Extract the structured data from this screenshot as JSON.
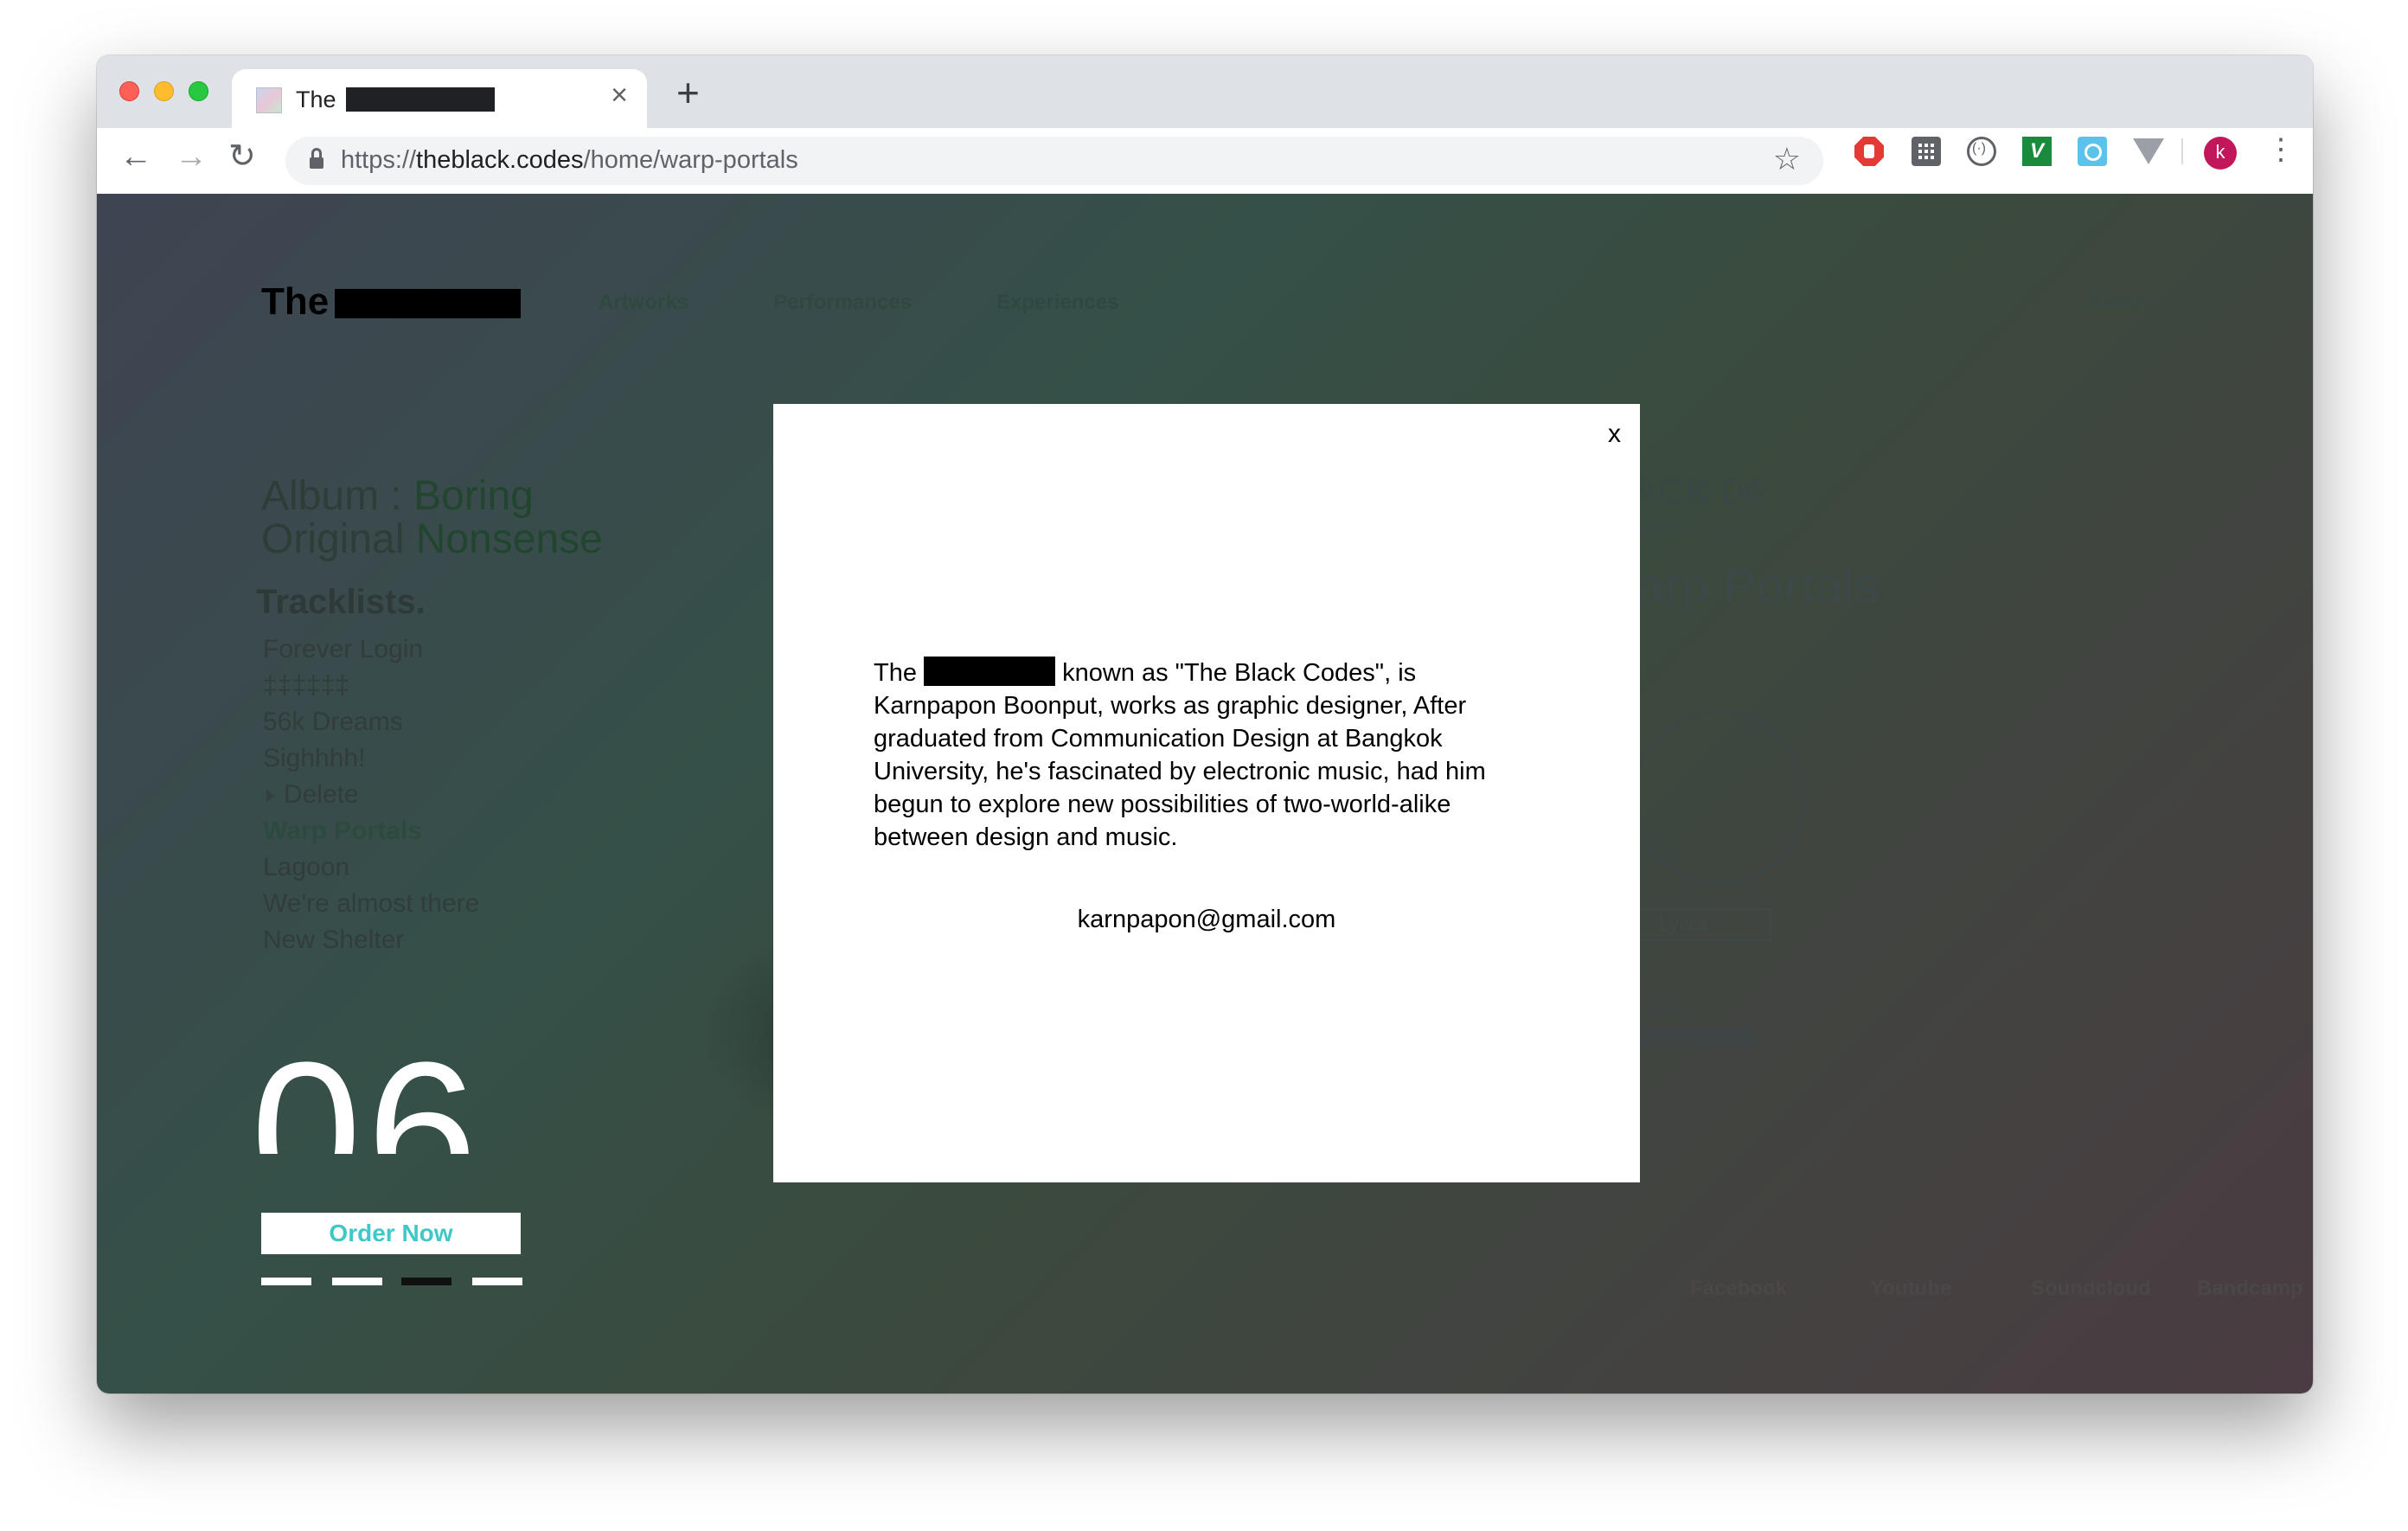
{
  "browser": {
    "tab": {
      "title": "The"
    },
    "new_tab_label": "+",
    "tab_close_label": "×",
    "url": {
      "prefix": "https://",
      "host": "theblack.codes",
      "path": "/home/warp-portals"
    },
    "profile_initial": "k",
    "extension_icons": [
      "stop-sign-icon",
      "grid-icon",
      "target-icon",
      "v-icon",
      "circle-icon",
      "triangle-icon"
    ]
  },
  "site": {
    "logo_text": "The",
    "nav": [
      "Artworks",
      "Performances",
      "Experiences"
    ],
    "about": "About",
    "album": {
      "label": "Album",
      "sep": " : ",
      "name": "Boring",
      "line2_a": "Original ",
      "line2_b": "Nonsense"
    },
    "tracklists_title": "Tracklists.",
    "tracks": [
      "Forever Login",
      "‡‡‡‡‡‡",
      "56k Dreams",
      "Sighhhh!",
      "Delete",
      "Warp Portals",
      "Lagoon",
      "We're almost there",
      "New Shelter"
    ],
    "big_number": "06",
    "order_button": "Order Now",
    "track_heading": "ACK 06",
    "release_date": "ed 15.11.2017",
    "track_name": "arp Portals",
    "lyrics_button": "Lyrics",
    "small_text": "k",
    "mapped_by": "pped by",
    "social": [
      "Facebook",
      "Youtube",
      "Soundcloud",
      "Bandcamp"
    ]
  },
  "modal": {
    "close_label": "x",
    "text_before": "The",
    "text_after": " known as \"The Black Codes\", is Karnpapon Boonput, works as graphic designer, After graduated from Communication Design at Bangkok University, he's fascinated by electronic music, had him begun to explore new possibilities of two-world-alike between design and music.",
    "email": "karnpapon@gmail.com"
  },
  "colors": {
    "order_button_text": "#3ec8c8",
    "avatar": "#c2185b"
  }
}
